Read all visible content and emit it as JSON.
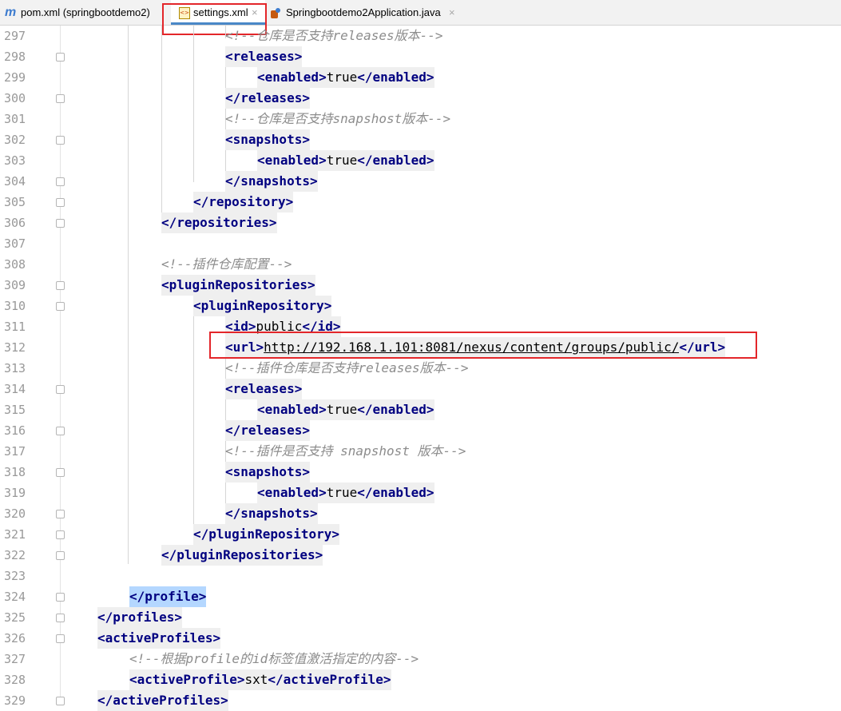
{
  "tabs": [
    {
      "label": "pom.xml (springbootdemo2)",
      "icon": "maven-m-icon",
      "active": false
    },
    {
      "label": "settings.xml",
      "icon": "xml-file-icon",
      "active": true
    },
    {
      "label": "Springbootdemo2Application.java",
      "icon": "java-class-icon",
      "active": false
    }
  ],
  "close_glyph": "×",
  "maven_glyph": "m",
  "xml_glyph": "<>",
  "code_lines": [
    {
      "num": "297",
      "fold": false,
      "segments": [
        {
          "t": "cm",
          "v": "<!--仓库是否支持releases版本-->"
        }
      ]
    },
    {
      "num": "298",
      "fold": true,
      "segments": [
        {
          "t": "tag",
          "v": "<releases>"
        }
      ]
    },
    {
      "num": "299",
      "fold": false,
      "segments": [
        {
          "t": "tag",
          "v": "<enabled>"
        },
        {
          "t": "val",
          "v": "true"
        },
        {
          "t": "tag",
          "v": "</enabled>"
        }
      ]
    },
    {
      "num": "300",
      "fold": true,
      "segments": [
        {
          "t": "tag",
          "v": "</releases>"
        }
      ]
    },
    {
      "num": "301",
      "fold": false,
      "segments": [
        {
          "t": "cm",
          "v": "<!--仓库是否支持snapshost版本-->"
        }
      ]
    },
    {
      "num": "302",
      "fold": true,
      "segments": [
        {
          "t": "tag",
          "v": "<snapshots>"
        }
      ]
    },
    {
      "num": "303",
      "fold": false,
      "segments": [
        {
          "t": "tag",
          "v": "<enabled>"
        },
        {
          "t": "val",
          "v": "true"
        },
        {
          "t": "tag",
          "v": "</enabled>"
        }
      ]
    },
    {
      "num": "304",
      "fold": true,
      "segments": [
        {
          "t": "tag",
          "v": "</snapshots>"
        }
      ]
    },
    {
      "num": "305",
      "fold": true,
      "segments": [
        {
          "t": "tag",
          "v": "</repository>"
        }
      ]
    },
    {
      "num": "306",
      "fold": true,
      "segments": [
        {
          "t": "tag",
          "v": "</repositories>"
        }
      ]
    },
    {
      "num": "307",
      "fold": false,
      "segments": []
    },
    {
      "num": "308",
      "fold": false,
      "segments": [
        {
          "t": "cm",
          "v": "<!--插件仓库配置-->"
        }
      ]
    },
    {
      "num": "309",
      "fold": true,
      "segments": [
        {
          "t": "tag",
          "v": "<pluginRepositories>"
        }
      ]
    },
    {
      "num": "310",
      "fold": true,
      "segments": [
        {
          "t": "tag",
          "v": "<pluginRepository>"
        }
      ]
    },
    {
      "num": "311",
      "fold": false,
      "segments": [
        {
          "t": "tag",
          "v": "<id>"
        },
        {
          "t": "val",
          "v": "public"
        },
        {
          "t": "tag",
          "v": "</id>"
        }
      ]
    },
    {
      "num": "312",
      "fold": false,
      "segments": [
        {
          "t": "tag",
          "v": "<url>"
        },
        {
          "t": "url",
          "v": "http://192.168.1.101:8081/nexus/content/groups/public/"
        },
        {
          "t": "tag",
          "v": "</url>"
        }
      ]
    },
    {
      "num": "313",
      "fold": false,
      "segments": [
        {
          "t": "cm",
          "v": "<!--插件仓库是否支持releases版本-->"
        }
      ]
    },
    {
      "num": "314",
      "fold": true,
      "segments": [
        {
          "t": "tag",
          "v": "<releases>"
        }
      ]
    },
    {
      "num": "315",
      "fold": false,
      "segments": [
        {
          "t": "tag",
          "v": "<enabled>"
        },
        {
          "t": "val",
          "v": "true"
        },
        {
          "t": "tag",
          "v": "</enabled>"
        }
      ]
    },
    {
      "num": "316",
      "fold": true,
      "segments": [
        {
          "t": "tag",
          "v": "</releases>"
        }
      ]
    },
    {
      "num": "317",
      "fold": false,
      "segments": [
        {
          "t": "cm",
          "v": "<!--插件是否支持 snapshost 版本-->"
        }
      ]
    },
    {
      "num": "318",
      "fold": true,
      "segments": [
        {
          "t": "tag",
          "v": "<snapshots>"
        }
      ]
    },
    {
      "num": "319",
      "fold": false,
      "segments": [
        {
          "t": "tag",
          "v": "<enabled>"
        },
        {
          "t": "val",
          "v": "true"
        },
        {
          "t": "tag",
          "v": "</enabled>"
        }
      ]
    },
    {
      "num": "320",
      "fold": true,
      "segments": [
        {
          "t": "tag",
          "v": "</snapshots>"
        }
      ]
    },
    {
      "num": "321",
      "fold": true,
      "segments": [
        {
          "t": "tag",
          "v": "</pluginRepository>"
        }
      ]
    },
    {
      "num": "322",
      "fold": true,
      "segments": [
        {
          "t": "tag",
          "v": "</pluginRepositories>"
        }
      ]
    },
    {
      "num": "323",
      "fold": false,
      "segments": []
    },
    {
      "num": "324",
      "fold": true,
      "segments": [
        {
          "t": "hl",
          "v": "</profile>"
        }
      ]
    },
    {
      "num": "325",
      "fold": true,
      "segments": [
        {
          "t": "tag",
          "v": "</profiles>"
        }
      ]
    },
    {
      "num": "326",
      "fold": true,
      "segments": [
        {
          "t": "tag",
          "v": "<activeProfiles>"
        }
      ]
    },
    {
      "num": "327",
      "fold": false,
      "segments": [
        {
          "t": "cm",
          "v": "<!--根据profile的id标签值激活指定的内容-->"
        }
      ]
    },
    {
      "num": "328",
      "fold": false,
      "segments": [
        {
          "t": "tag",
          "v": "<activeProfile>"
        },
        {
          "t": "val",
          "v": "sxt"
        },
        {
          "t": "tag",
          "v": "</activeProfile>"
        }
      ]
    },
    {
      "num": "329",
      "fold": true,
      "segments": [
        {
          "t": "tag",
          "v": "</activeProfiles>"
        }
      ]
    }
  ]
}
